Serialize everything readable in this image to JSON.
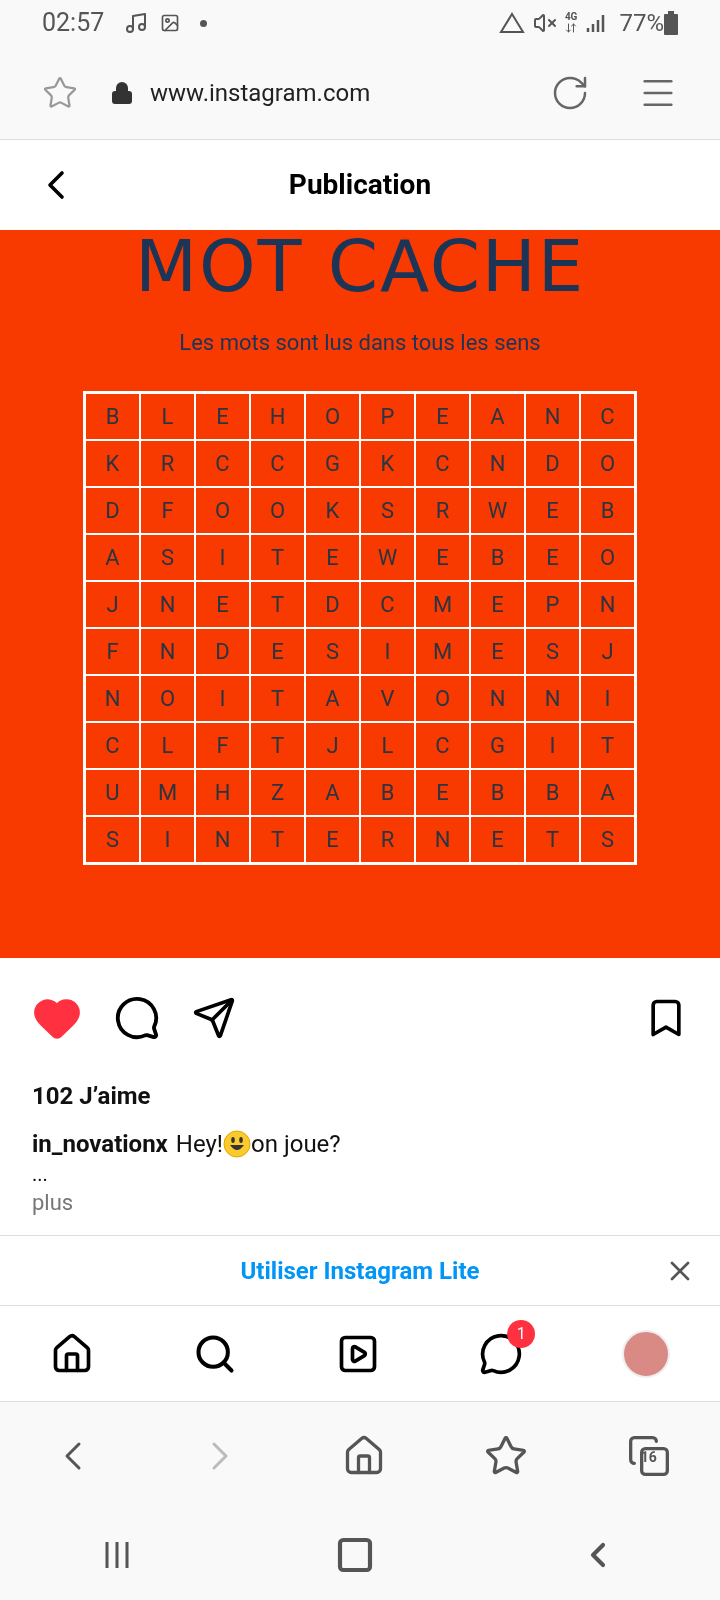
{
  "status_bar": {
    "time": "02:57",
    "battery": "77%",
    "network": "4G"
  },
  "browser": {
    "url": "www.instagram.com"
  },
  "header": {
    "title": "Publication"
  },
  "post": {
    "title": "MOT CACHE",
    "subtitle": "Les mots sont lus dans tous les sens",
    "grid": [
      [
        "B",
        "L",
        "E",
        "H",
        "O",
        "P",
        "E",
        "A",
        "N",
        "C"
      ],
      [
        "K",
        "R",
        "C",
        "C",
        "G",
        "K",
        "C",
        "N",
        "D",
        "O"
      ],
      [
        "D",
        "F",
        "O",
        "O",
        "K",
        "S",
        "R",
        "W",
        "E",
        "B"
      ],
      [
        "A",
        "S",
        "I",
        "T",
        "E",
        "W",
        "E",
        "B",
        "E",
        "O"
      ],
      [
        "J",
        "N",
        "E",
        "T",
        "D",
        "C",
        "M",
        "E",
        "P",
        "N"
      ],
      [
        "F",
        "N",
        "D",
        "E",
        "S",
        "I",
        "M",
        "E",
        "S",
        "J"
      ],
      [
        "N",
        "O",
        "I",
        "T",
        "A",
        "V",
        "O",
        "N",
        "N",
        "I"
      ],
      [
        "C",
        "L",
        "F",
        "T",
        "J",
        "L",
        "C",
        "G",
        "I",
        "T"
      ],
      [
        "U",
        "M",
        "H",
        "Z",
        "A",
        "B",
        "E",
        "B",
        "B",
        "A"
      ],
      [
        "S",
        "I",
        "N",
        "T",
        "E",
        "R",
        "N",
        "E",
        "T",
        "S"
      ]
    ]
  },
  "actions": {
    "liked": true,
    "saved": false
  },
  "likes": "102 J’aime",
  "caption": {
    "user": "in_novationx",
    "text_before": "Hey!",
    "text_after": "on joue?",
    "ellipsis": "...",
    "more": "plus"
  },
  "banner": {
    "label": "Utiliser Instagram Lite"
  },
  "bottom_nav": {
    "messages_badge": "1"
  },
  "browser_nav": {
    "forward_disabled": true,
    "tabs_count": "16"
  }
}
